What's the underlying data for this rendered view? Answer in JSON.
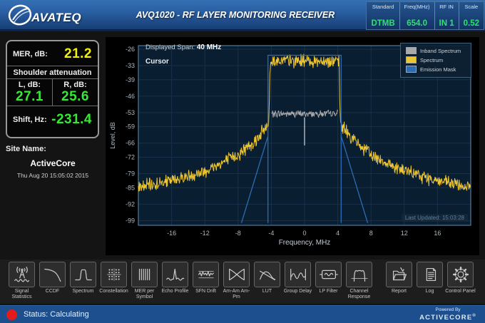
{
  "topbar": {
    "logo_text": "AVATEQ",
    "title": "AVQ1020 - RF LAYER MONITORING RECEIVER",
    "value_color": "#2ee26e",
    "info": [
      {
        "label": "Standard",
        "value": "DTMB"
      },
      {
        "label": "Freq(MHz)",
        "value": "654.0"
      },
      {
        "label": "RF IN",
        "value": "IN 1"
      },
      {
        "label": "Scale",
        "value": "0.52"
      }
    ]
  },
  "left_panel": {
    "mer_label": "MER, dB:",
    "mer_value": "21.2",
    "mer_color": "#f2ef0a",
    "green": "#35e935",
    "shoulder_title": "Shoulder attenuation",
    "l_label": "L, dB:",
    "l_value": "27.1",
    "r_label": "R, dB:",
    "r_value": "25.6",
    "shift_label": "Shift, Hz:",
    "shift_value": "-231.4",
    "site_name_label": "Site Name:",
    "site_name": "ActiveCore",
    "datetime": "Thu Aug 20 15:05:02 2015"
  },
  "chart": {
    "span_label": "Displayed Span:",
    "span_value": "40 MHz",
    "cursor_label": "Cursor",
    "last_updated": "Last Updated: 15:03:28"
  },
  "chart_data": {
    "type": "line",
    "xlabel": "Frequency, MHz",
    "ylabel": "Level, dB",
    "xlim": [
      -20,
      20
    ],
    "ylim_top": -24.5,
    "ylim_bottom": -101,
    "x_ticks": [
      -16,
      -12,
      -8,
      -4,
      0,
      4,
      8,
      12,
      16
    ],
    "y_ticks": [
      -26,
      -33,
      -39,
      -46,
      -53,
      -59,
      -66,
      -72,
      -79,
      -85,
      -92,
      -99
    ],
    "grid": true,
    "legend_position": "top-right",
    "series": [
      {
        "name": "Inband Spectrum",
        "color": "#a9a9a9",
        "noise": 1.3,
        "points": [
          [
            -4,
            -53.5
          ],
          [
            4,
            -53.5
          ]
        ]
      },
      {
        "name": "Spectrum",
        "color": "#edc531",
        "noise": 2.5,
        "points": [
          [
            -20,
            -85
          ],
          [
            -16,
            -82
          ],
          [
            -12,
            -78
          ],
          [
            -8,
            -71
          ],
          [
            -6,
            -65
          ],
          [
            -5,
            -61
          ],
          [
            -4.5,
            -58.5
          ],
          [
            -4.3,
            -57
          ],
          [
            -4.15,
            -32
          ],
          [
            -4,
            -31
          ],
          [
            4,
            -31
          ],
          [
            4.15,
            -32
          ],
          [
            4.3,
            -57
          ],
          [
            4.5,
            -58.5
          ],
          [
            5,
            -61
          ],
          [
            6,
            -65
          ],
          [
            8,
            -71
          ],
          [
            12,
            -78
          ],
          [
            16,
            -82
          ],
          [
            20,
            -85
          ]
        ]
      },
      {
        "name": "Emission Mask",
        "color": "#2c6cb4",
        "noise": 0,
        "segments": [
          [
            [
              -4.4,
              -100
            ],
            [
              -4.4,
              -28.6
            ],
            [
              4.4,
              -28.6
            ],
            [
              4.4,
              -100
            ]
          ],
          [
            [
              -4.4,
              -63
            ],
            [
              -7.6,
              -100
            ]
          ],
          [
            [
              4.4,
              -63
            ],
            [
              7.6,
              -100
            ]
          ]
        ]
      }
    ],
    "cursor": {
      "x": 0,
      "y_top": -55,
      "y_bottom": -67,
      "color": "#ffffff"
    }
  },
  "toolbar": {
    "buttons": [
      {
        "label": "Signal Statistics",
        "icon": "antenna-icon"
      },
      {
        "label": "CCDF",
        "icon": "ccdf-curve-icon"
      },
      {
        "label": "Spectrum",
        "icon": "spectrum-shape-icon"
      },
      {
        "label": "Constellation",
        "icon": "dot-grid-icon"
      },
      {
        "label": "MER per Symbol",
        "icon": "vertical-bars-icon"
      },
      {
        "label": "Echo Profile",
        "icon": "spike-icon"
      },
      {
        "label": "SFN Drift",
        "icon": "noisy-line-icon"
      },
      {
        "label": "Am-Am Am-Pm",
        "icon": "bowtie-icon"
      },
      {
        "label": "LUT",
        "icon": "crossing-curves-icon"
      },
      {
        "label": "Group Delay",
        "icon": "delay-curve-icon"
      },
      {
        "label": "LP Filter",
        "icon": "filter-box-icon"
      },
      {
        "label": "Channel Response",
        "icon": "response-brackets-icon"
      },
      {
        "label": "Report",
        "icon": "report-folder-icon"
      },
      {
        "label": "Log",
        "icon": "log-document-icon"
      },
      {
        "label": "Control Panel",
        "icon": "gear-icon"
      }
    ]
  },
  "statusbar": {
    "status_text": "Status: Calculating",
    "status_dot_color": "#e31b1b",
    "powered_by": "Powered By",
    "brand": "ACTIVECORE",
    "reg_mark": "®"
  }
}
